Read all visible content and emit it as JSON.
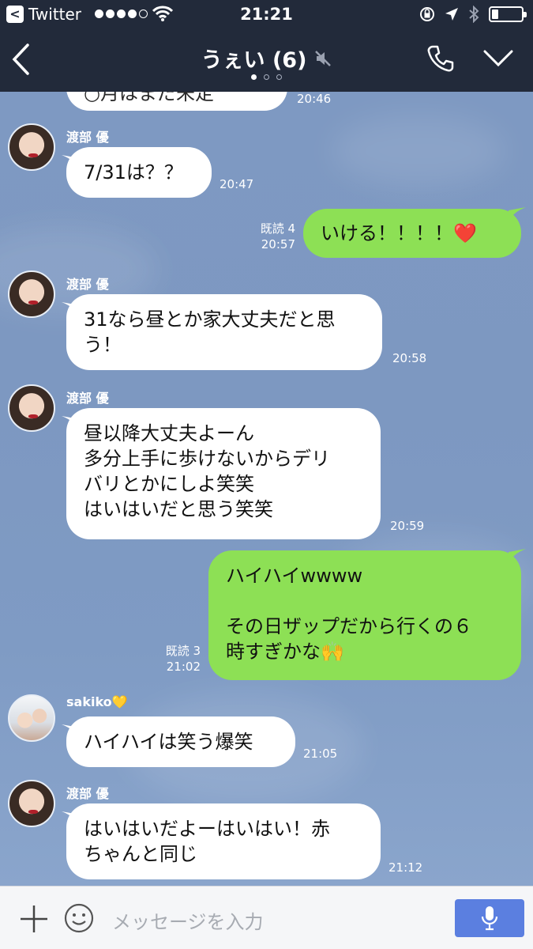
{
  "status": {
    "app_back": "Twitter",
    "time": "21:21"
  },
  "nav": {
    "title": "うぇい (6)"
  },
  "messages": [
    {
      "partial_text": "○月はまだ未定",
      "time": "20:46"
    },
    {
      "sender": "渡部 優",
      "text": "7/31は？？",
      "time": "20:47"
    },
    {
      "read": "既読 4",
      "time": "20:57",
      "text": "いける！！！！❤️"
    },
    {
      "sender": "渡部 優",
      "lines": [
        "31なら昼とか家大丈夫だと思",
        "う！"
      ],
      "time": "20:58"
    },
    {
      "sender": "渡部 優",
      "lines": [
        "昼以降大丈夫よーん",
        "多分上手に歩けないからデリ",
        "バリとかにしよ笑笑",
        "はいはいだと思う笑笑"
      ],
      "time": "20:59"
    },
    {
      "read": "既読 3",
      "time": "21:02",
      "lines": [
        "ハイハイwwww",
        "",
        "その日ザップだから行くの６",
        "時すぎかな🙌"
      ]
    },
    {
      "sender": "sakiko💛",
      "text": "ハイハイは笑う爆笑",
      "time": "21:05"
    },
    {
      "sender": "渡部 優",
      "lines": [
        "はいはいだよーはいはい！赤",
        "ちゃんと同じ"
      ],
      "time": "21:12"
    }
  ],
  "input": {
    "placeholder": "メッセージを入力"
  },
  "colors": {
    "header_bg": "#222a3a",
    "outgoing_bubble": "#8de055",
    "incoming_bubble": "#ffffff",
    "mic_button": "#5b7fe0"
  }
}
